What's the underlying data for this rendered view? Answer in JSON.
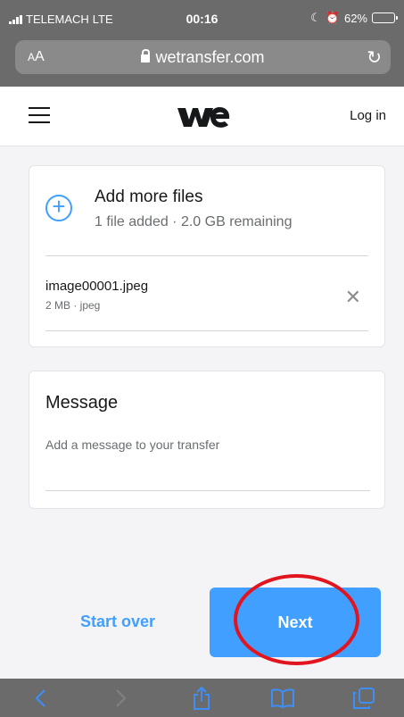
{
  "status_bar": {
    "carrier": "TELEMACH",
    "network": "LTE",
    "time": "00:16",
    "battery": "62%",
    "battery_level": 0.62
  },
  "url_bar": {
    "text_size_label": "AA",
    "url": "wetransfer.com"
  },
  "header": {
    "logo": "we",
    "login_label": "Log in"
  },
  "upload": {
    "add_title": "Add more files",
    "add_subtitle": "1 file added · 2.0 GB remaining",
    "files": [
      {
        "name": "image00001.jpeg",
        "meta": "2 MB · jpeg"
      }
    ]
  },
  "message": {
    "label": "Message",
    "placeholder": "Add a message to your transfer"
  },
  "actions": {
    "start_over_label": "Start over",
    "next_label": "Next"
  },
  "icons": {
    "menu": "hamburger-icon",
    "add": "plus-circle-icon",
    "remove": "close-icon",
    "toolbar": [
      "back-icon",
      "forward-icon",
      "share-icon",
      "bookmarks-icon",
      "tabs-icon"
    ]
  },
  "colors": {
    "accent": "#409fff",
    "highlight": "#e2141e",
    "chrome": "#6b6b6b"
  }
}
